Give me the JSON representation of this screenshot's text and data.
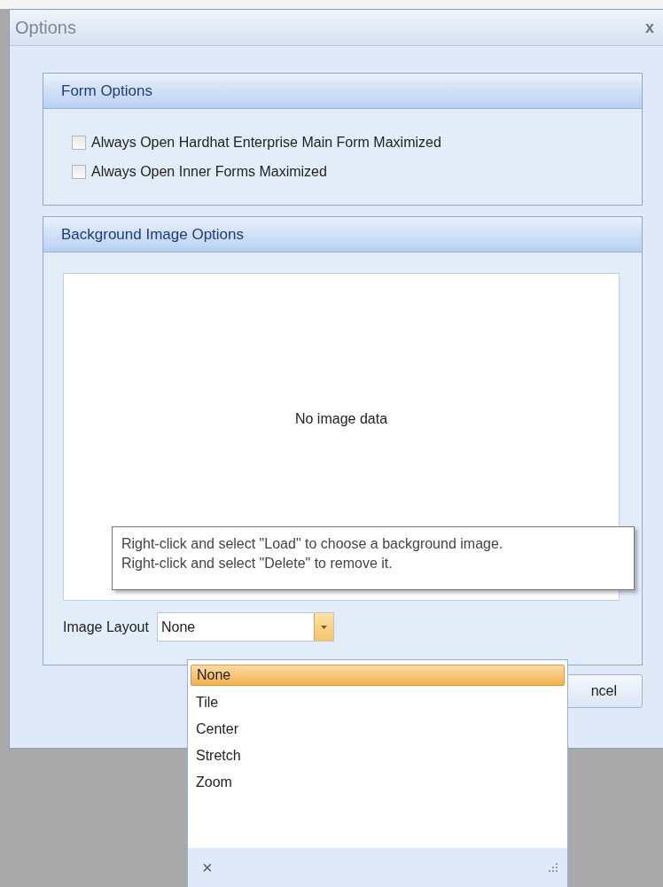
{
  "window": {
    "title": "Options",
    "close": "x"
  },
  "form_options": {
    "title": "Form Options",
    "checkboxes": [
      {
        "label": "Always Open Hardhat Enterprise Main Form Maximized",
        "checked": false
      },
      {
        "label": "Always Open Inner Forms Maximized",
        "checked": false
      }
    ]
  },
  "background_image_options": {
    "title": "Background Image Options",
    "image_placeholder": "No image data",
    "tooltip": [
      "Right-click and select \"Load\" to choose a background image.",
      "Right-click and select \"Delete\" to remove it."
    ],
    "image_layout": {
      "label": "Image Layout",
      "value": "None"
    }
  },
  "buttons": [
    {
      "label": "ncel"
    }
  ],
  "dropdown": {
    "options": [
      {
        "label": "None",
        "selected": true
      },
      {
        "label": "Tile",
        "selected": false
      },
      {
        "label": "Center",
        "selected": false
      },
      {
        "label": "Stretch",
        "selected": false
      },
      {
        "label": "Zoom",
        "selected": false
      }
    ],
    "clear": "×"
  }
}
